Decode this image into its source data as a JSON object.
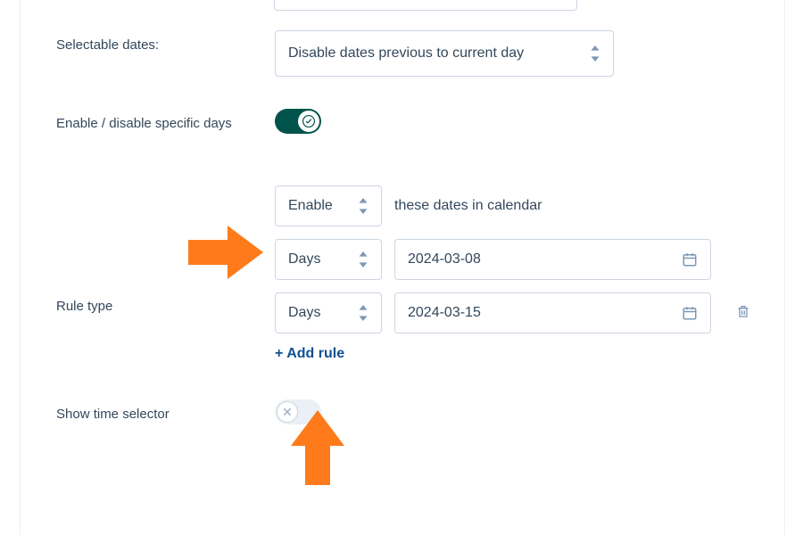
{
  "selectable_dates": {
    "label": "Selectable dates:",
    "value": "Disable dates previous to current day"
  },
  "enable_days": {
    "label": "Enable / disable specific days",
    "enabled": true
  },
  "rule_type": {
    "label": "Rule type",
    "action": "Enable",
    "action_suffix": "these dates in calendar",
    "rules": [
      {
        "unit": "Days",
        "date": "2024-03-08"
      },
      {
        "unit": "Days",
        "date": "2024-03-15"
      }
    ],
    "add_label": "+ Add rule"
  },
  "time_selector": {
    "label": "Show time selector",
    "enabled": false
  }
}
